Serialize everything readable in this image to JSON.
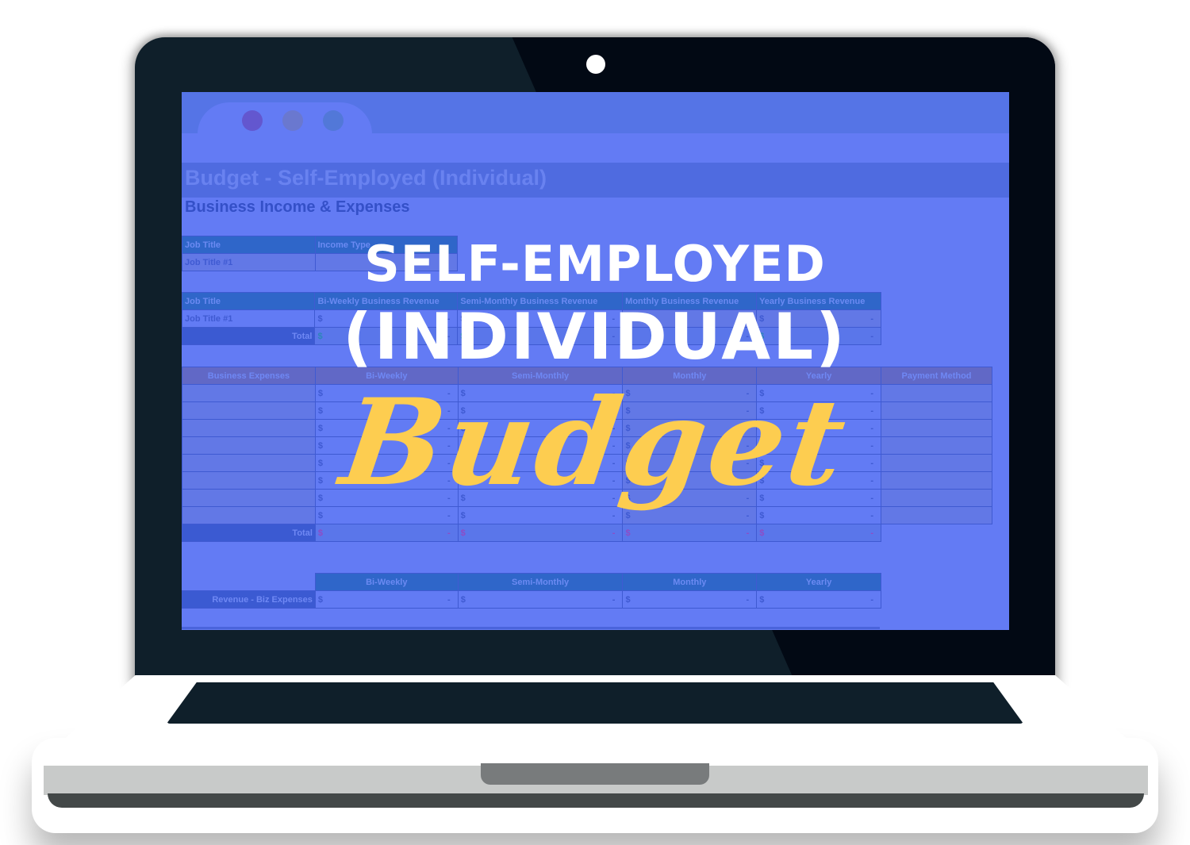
{
  "overlay": {
    "line1": "SELF-EMPLOYED",
    "line2": "(INDIVIDUAL)",
    "script_word": "Budget"
  },
  "colors": {
    "screen_bg": "#637bf4",
    "script_yellow": "#fdcd50",
    "lid_dark": "#0f1f2a",
    "base_white": "#ffffff"
  },
  "browser": {
    "window_controls": [
      "close-dot",
      "minimize-dot",
      "maximize-dot"
    ]
  },
  "sheet": {
    "title": "Budget  - Self-Employed (Individual)",
    "subtitle": "Business Income & Expenses",
    "job_table": {
      "headers": [
        "Job Title",
        "Income Type"
      ],
      "rows": [
        [
          "Job Title #1",
          ""
        ]
      ]
    },
    "revenue_table": {
      "headers": [
        "Job Title",
        "Bi-Weekly Business Revenue",
        "Semi-Monthly Business Revenue",
        "Monthly Business Revenue",
        "Yearly Business Revenue"
      ],
      "rows": [
        {
          "label": "Job Title #1",
          "values": [
            {
              "cur": "$",
              "val": "-"
            },
            {
              "cur": "$",
              "val": "-"
            },
            {
              "cur": "$",
              "val": "-"
            },
            {
              "cur": "$",
              "val": "-"
            }
          ]
        }
      ],
      "total": {
        "label": "Total",
        "values": [
          {
            "cur": "$",
            "val": "-"
          },
          {
            "cur": "$",
            "val": "-"
          },
          {
            "cur": "$",
            "val": "-"
          },
          {
            "cur": "$",
            "val": "-"
          }
        ]
      }
    },
    "expenses_table": {
      "headers": [
        "Business Expenses",
        "Bi-Weekly",
        "Semi-Monthly",
        "Monthly",
        "Yearly",
        "Payment Method"
      ],
      "rows": [
        {
          "label": "",
          "values": [
            "-",
            "-",
            "-",
            "-"
          ],
          "payment": ""
        },
        {
          "label": "",
          "values": [
            "-",
            "-",
            "-",
            "-"
          ],
          "payment": ""
        },
        {
          "label": "",
          "values": [
            "-",
            "-",
            "-",
            "-"
          ],
          "payment": ""
        },
        {
          "label": "",
          "values": [
            "-",
            "-",
            "-",
            "-"
          ],
          "payment": ""
        },
        {
          "label": "",
          "values": [
            "-",
            "-",
            "-",
            "-"
          ],
          "payment": ""
        },
        {
          "label": "",
          "values": [
            "-",
            "-",
            "-",
            "-"
          ],
          "payment": ""
        },
        {
          "label": "",
          "values": [
            "-",
            "-",
            "-",
            "-"
          ],
          "payment": ""
        },
        {
          "label": "",
          "values": [
            "-",
            "-",
            "-",
            "-"
          ],
          "payment": ""
        }
      ],
      "currency": "$",
      "total": {
        "label": "Total",
        "values": [
          "-",
          "-",
          "-",
          "-"
        ]
      }
    },
    "net_table": {
      "headers": [
        "Bi-Weekly",
        "Semi-Monthly",
        "Monthly",
        "Yearly"
      ],
      "row_label": "Revenue - Biz Expenses",
      "currency": "$",
      "values": [
        "-",
        "-",
        "-",
        "-"
      ]
    }
  }
}
